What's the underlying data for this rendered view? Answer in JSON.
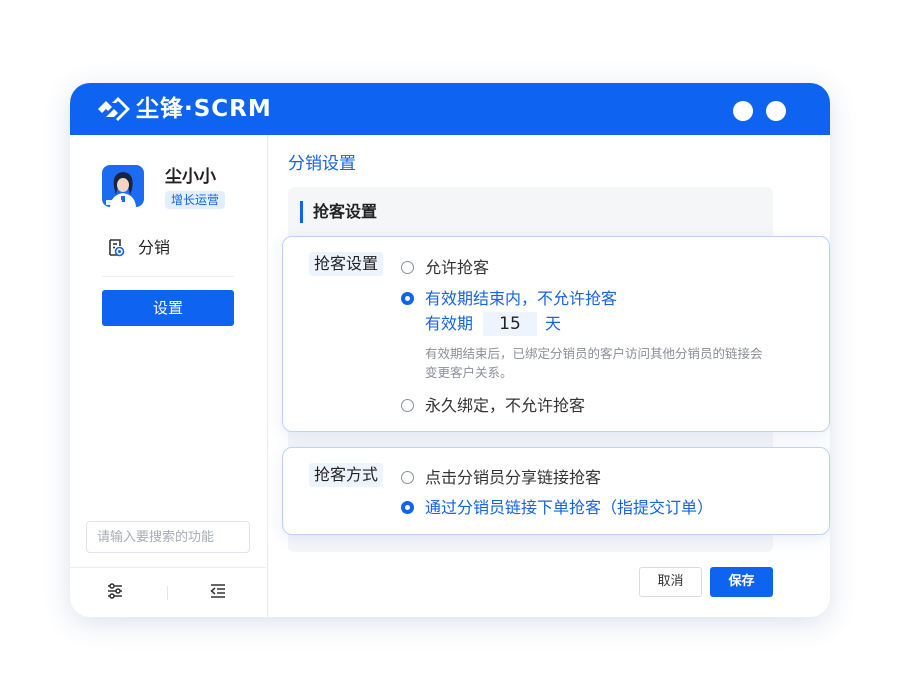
{
  "app": {
    "brand": "尘锋·SCRM",
    "logo_icon": "brand-logo-icon",
    "accent_color": "#0e64f1"
  },
  "sidebar": {
    "user": {
      "name": "尘小小",
      "role": "增长运营"
    },
    "items": [
      {
        "label": "分销",
        "icon": "distribution-icon"
      }
    ],
    "active_button": "设置",
    "search": {
      "placeholder": "请输入要搜索的功能"
    },
    "bottom_icons": [
      "sliders-icon",
      "collapse-menu-icon"
    ]
  },
  "main": {
    "title": "分销设置",
    "section_title": "抢客设置",
    "grab_settings": {
      "label": "抢客设置",
      "options": [
        {
          "label": "允许抢客",
          "selected": false
        },
        {
          "label": "有效期结束内，不允许抢客",
          "selected": true
        },
        {
          "label": "永久绑定，不允许抢客",
          "selected": false
        }
      ],
      "period": {
        "label": "有效期",
        "value": "15",
        "unit": "天"
      },
      "note": "有效期结束后，已绑定分销员的客户访问其他分销员的链接会变更客户关系。"
    },
    "grab_method": {
      "label": "抢客方式",
      "options": [
        {
          "label": "点击分销员分享链接抢客",
          "selected": false
        },
        {
          "label": "通过分销员链接下单抢客（指提交订单）",
          "selected": true
        }
      ]
    },
    "buttons": {
      "cancel": "取消",
      "save": "保存"
    }
  }
}
